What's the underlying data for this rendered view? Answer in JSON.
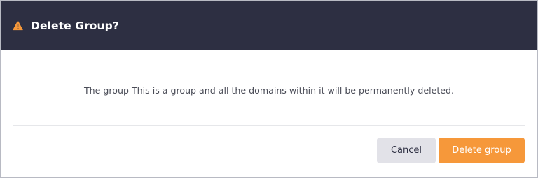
{
  "dialog": {
    "title": "Delete Group?",
    "title_icon": "warning-triangle-icon",
    "message": "The group This is a group and all the domains within it will be permanently deleted.",
    "cancel_label": "Cancel",
    "confirm_label": "Delete group"
  },
  "colors": {
    "header_bg": "#2d2f42",
    "warning_accent": "#f6983a",
    "confirm_button": "#f6983a",
    "cancel_button": "#e2e2e8"
  }
}
